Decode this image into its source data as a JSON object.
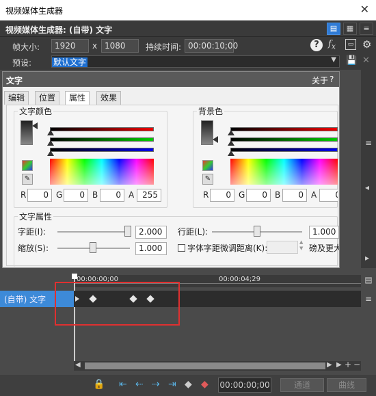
{
  "window": {
    "title": "视频媒体生成器",
    "close_glyph": "✕"
  },
  "generator": {
    "header": "视频媒体生成器: (自带) 文字",
    "frame_size_label": "帧大小:",
    "width": "1920",
    "x_label": "x",
    "height": "1080",
    "duration_label": "持续时间:",
    "duration": "00:00:10;00",
    "preset_label": "预设:",
    "preset_value": "默认文字"
  },
  "dialog": {
    "title": "文字",
    "about": "关于",
    "help_glyph": "?",
    "tabs": [
      "编辑",
      "位置",
      "属性",
      "效果"
    ],
    "active_tab": 2,
    "text_color": {
      "label": "文字颜色",
      "channels": [
        {
          "label": "R",
          "value": "0"
        },
        {
          "label": "G",
          "value": "0"
        },
        {
          "label": "B",
          "value": "0"
        },
        {
          "label": "A",
          "value": "255"
        }
      ]
    },
    "bg_color": {
      "label": "背景色",
      "channels": [
        {
          "label": "R",
          "value": "0"
        },
        {
          "label": "G",
          "value": "0"
        },
        {
          "label": "B",
          "value": "0"
        },
        {
          "label": "A",
          "value": "0"
        }
      ]
    },
    "text_props": {
      "label": "文字属性",
      "spacing_label": "字距(I):",
      "spacing_value": "2.000",
      "scale_label": "缩放(S):",
      "scale_value": "1.000",
      "line_label": "行距(L):",
      "line_value": "1.000",
      "kerning_label": "字体字距微调距离(K):",
      "kerning_more": "磅及更大"
    }
  },
  "timeline": {
    "time_start": "00:00:00;00",
    "time_mid": "00:00:04;29",
    "track_label": "(自带) 文字",
    "keyframes": [
      0.035,
      0.175,
      0.235
    ],
    "timecode": "00:00:00;00",
    "channel_btn": "通道",
    "curve_btn": "曲线"
  },
  "colors": {
    "accent": "#2f7bd6",
    "track_label_bg": "#3d8ad8",
    "highlight_box": "#e03030"
  }
}
